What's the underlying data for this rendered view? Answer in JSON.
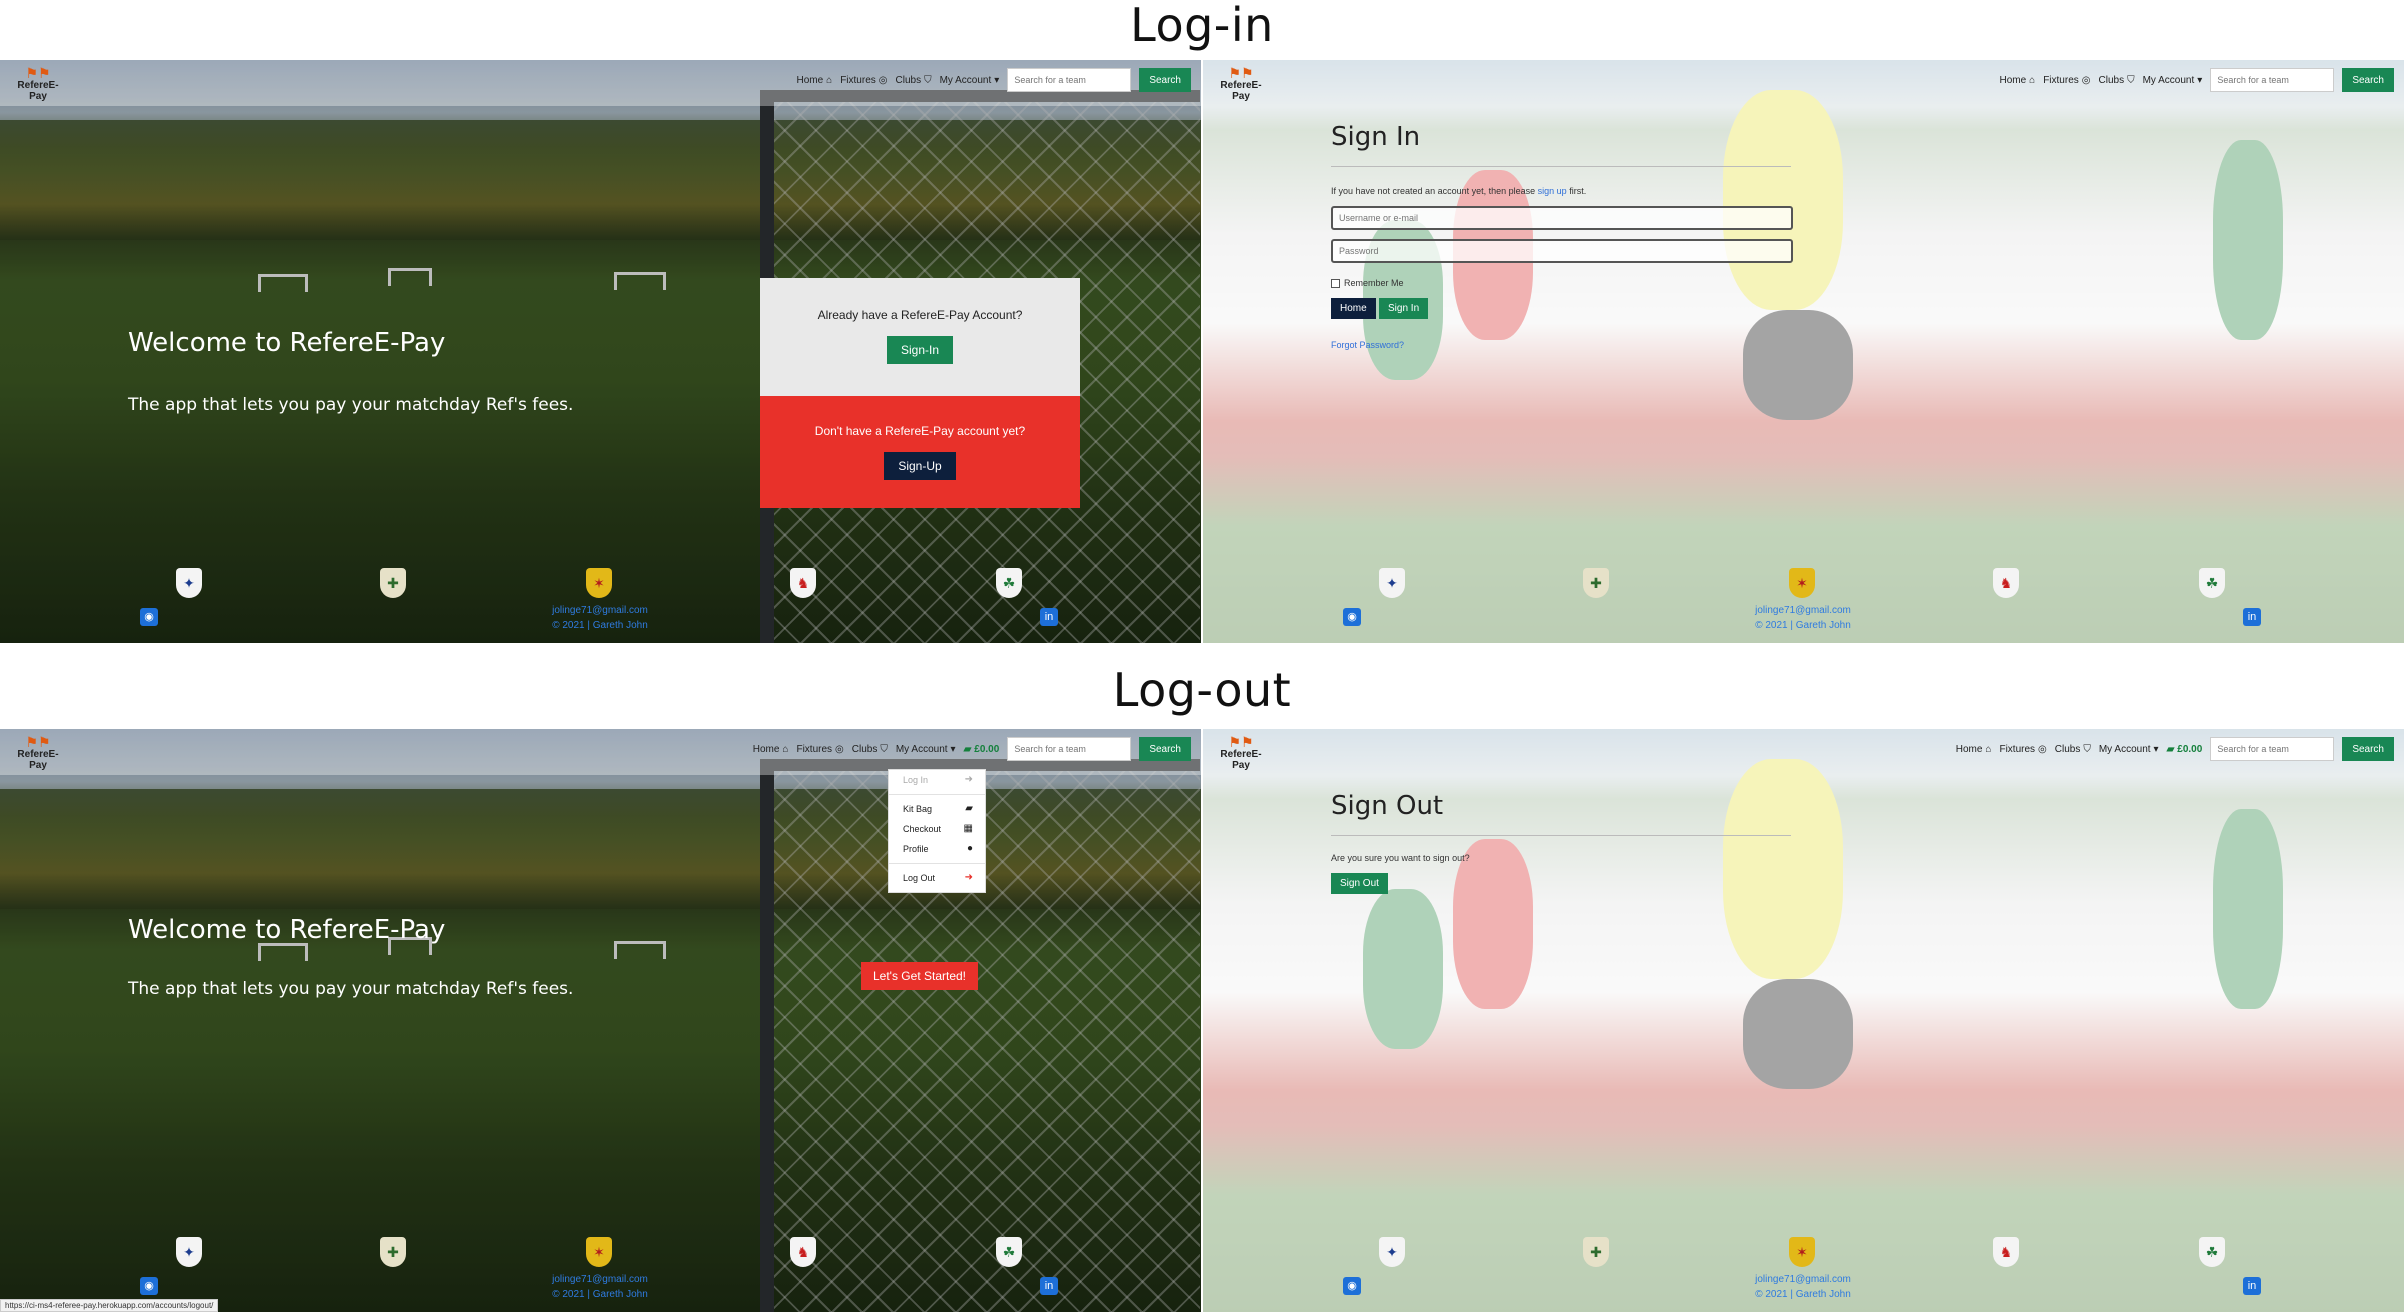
{
  "headings": {
    "login": "Log-in",
    "logout": "Log-out"
  },
  "nav": {
    "brand": "RefereE-Pay",
    "home": "Home",
    "fixtures": "Fixtures",
    "clubs": "Clubs",
    "my_account": "My Account",
    "bag_amount": "£0.00",
    "search_placeholder": "Search for a team",
    "search_button": "Search"
  },
  "hero": {
    "title": "Welcome to RefereE-Pay",
    "subtitle": "The app that lets you pay your matchday Ref's fees."
  },
  "account_card": {
    "have_account_text": "Already have a RefereE-Pay Account?",
    "sign_in_button": "Sign-In",
    "no_account_text": "Don't have a RefereE-Pay account yet?",
    "sign_up_button": "Sign-Up"
  },
  "cta_button": "Let's Get Started!",
  "dropdown": {
    "items": [
      {
        "label": "Log In",
        "icon": "sign-in-icon"
      },
      {
        "label": "Kit Bag",
        "icon": "bag-icon"
      },
      {
        "label": "Checkout",
        "icon": "checkout-icon"
      },
      {
        "label": "Profile",
        "icon": "user-icon"
      },
      {
        "label": "Log Out",
        "icon": "sign-out-icon"
      }
    ]
  },
  "sign_in": {
    "title": "Sign In",
    "note_prefix": "If you have not created an account yet, then please",
    "note_link": "sign up",
    "note_suffix": "first.",
    "username_placeholder": "Username or e-mail",
    "password_placeholder": "Password",
    "remember_me": "Remember Me",
    "home_button": "Home",
    "sign_in_button": "Sign In",
    "forgot_password": "Forgot Password?"
  },
  "sign_out": {
    "title": "Sign Out",
    "question": "Are you sure you want to sign out?",
    "sign_out_button": "Sign Out"
  },
  "footer": {
    "email": "jolinge71@gmail.com",
    "copyright": "© 2021 | Gareth John",
    "crests": [
      "england-crest-icon",
      "northern-ireland-crest-icon",
      "scotland-crest-icon",
      "wales-crest-icon",
      "ireland-crest-icon"
    ],
    "social": [
      "github-icon",
      "linkedin-icon"
    ]
  },
  "status_url": "https://ci-ms4-referee-pay.herokuapp.com/accounts/logout/",
  "colors": {
    "green": "#198754",
    "navy": "#0d1f3c",
    "red": "#e8312a",
    "link_blue": "#2f7be0"
  }
}
